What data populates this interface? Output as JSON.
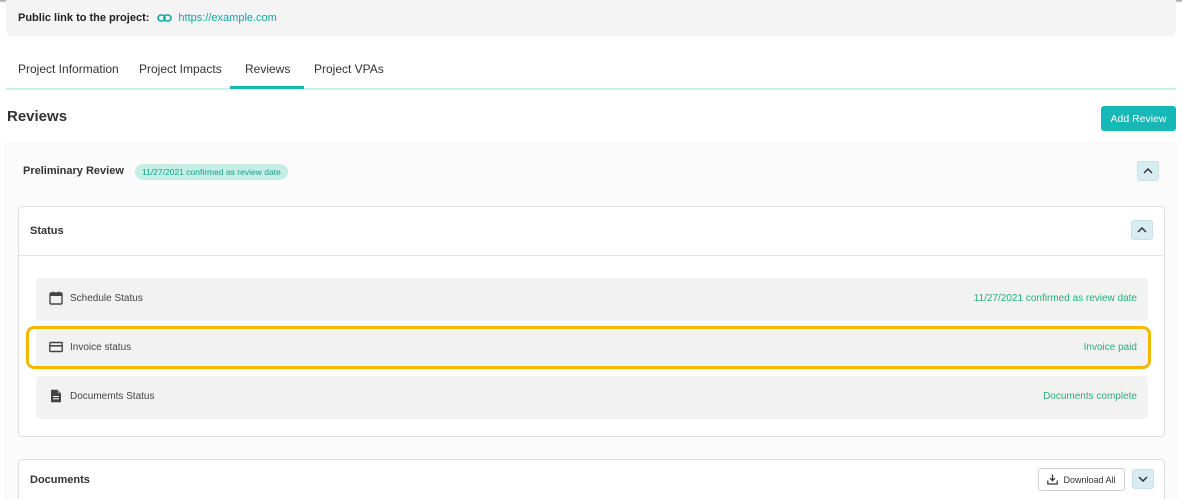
{
  "public_link": {
    "label": "Public link to the project:",
    "url": "https://example.com"
  },
  "tabs": [
    {
      "label": "Project Information",
      "active": false
    },
    {
      "label": "Project Impacts",
      "active": false
    },
    {
      "label": "Reviews",
      "active": true
    },
    {
      "label": "Project VPAs",
      "active": false
    }
  ],
  "reviews": {
    "title": "Reviews",
    "add_button": "Add Review"
  },
  "preliminary": {
    "title": "Preliminary Review",
    "badge": "11/27/2021 confirmed as review date"
  },
  "status": {
    "title": "Status",
    "rows": [
      {
        "icon": "calendar-icon",
        "label": "Schedule Status",
        "value": "11/27/2021 confirmed as review date"
      },
      {
        "icon": "credit-card-icon",
        "label": "Invoice status",
        "value": "Invoice paid"
      },
      {
        "icon": "document-icon",
        "label": "Documemts Status",
        "value": "Documents complete"
      }
    ]
  },
  "documents": {
    "title": "Documents",
    "download_button": "Download All"
  },
  "colors": {
    "accent": "#16b7b7",
    "status_value": "#27ae7a",
    "highlight": "#f2b800"
  }
}
